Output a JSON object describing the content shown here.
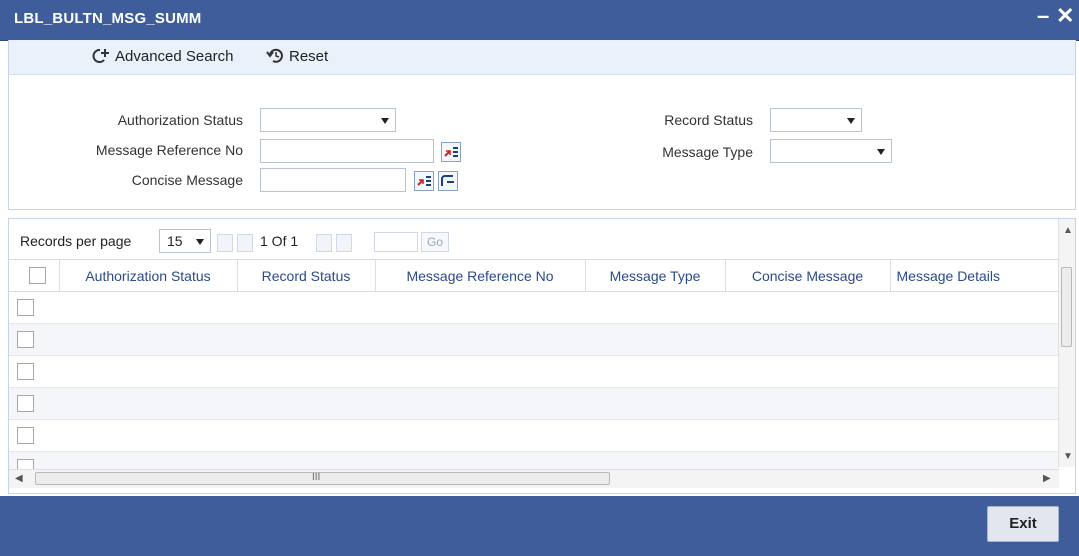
{
  "window": {
    "title": "LBL_BULTN_MSG_SUMM",
    "minimize_label": "–",
    "close_label": "✕"
  },
  "toolbar": {
    "advanced_search_label": "Advanced Search",
    "reset_label": "Reset"
  },
  "search": {
    "authorization_status_label": "Authorization Status",
    "authorization_status_value": "",
    "message_reference_no_label": "Message Reference No",
    "message_reference_no_value": "",
    "concise_message_label": "Concise Message",
    "concise_message_value": "",
    "record_status_label": "Record Status",
    "record_status_value": "",
    "message_type_label": "Message Type",
    "message_type_value": ""
  },
  "pager": {
    "records_per_page_label": "Records per page",
    "records_per_page_value": "15",
    "page_info": "1 Of 1",
    "go_label": "Go"
  },
  "grid": {
    "columns": [
      "Authorization Status",
      "Record Status",
      "Message Reference No",
      "Message Type",
      "Concise Message",
      "Message Details"
    ],
    "hscroll_mark": "III"
  },
  "footer": {
    "exit_label": "Exit"
  },
  "colors": {
    "header_blue": "#3e5d9a",
    "column_text": "#2b4a8a"
  }
}
